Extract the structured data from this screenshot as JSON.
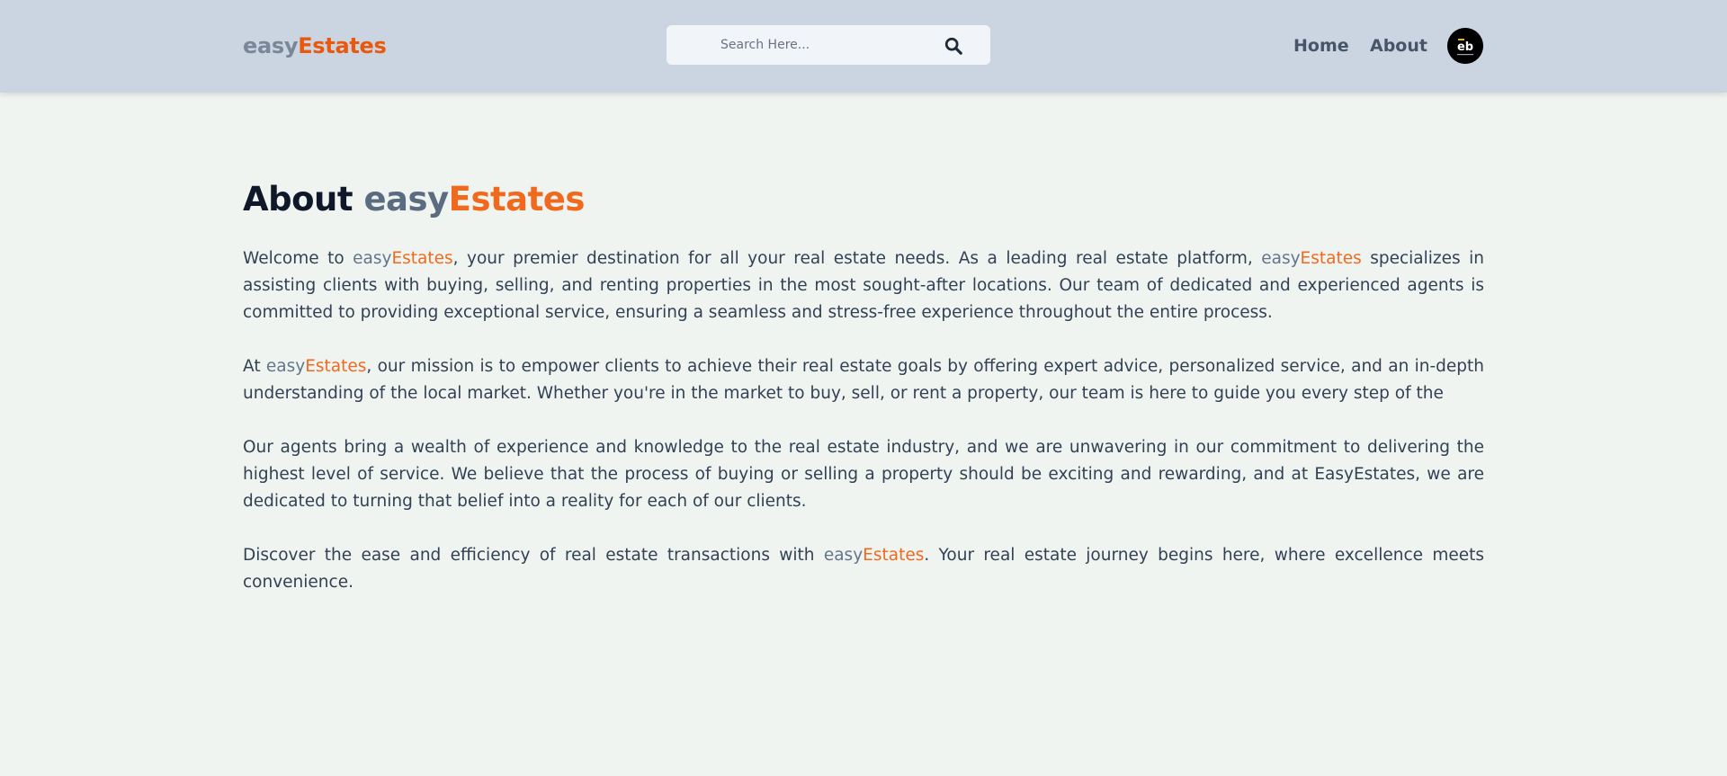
{
  "header": {
    "logo": {
      "prefix": "easy",
      "suffix": "Estates"
    },
    "search": {
      "placeholder": "Search Here...",
      "value": ""
    },
    "nav": {
      "home": "Home",
      "about": "About"
    },
    "avatar_label": "eb"
  },
  "brand": {
    "prefix": "easy",
    "suffix": "Estates"
  },
  "page": {
    "title_lead": "About ",
    "paragraphs": {
      "p1": {
        "a": "Welcome to ",
        "b": ", your premier destination for all your real estate needs. As a leading real estate platform, ",
        "c": " specializes in assisting clients with buying, selling, and renting properties in the most sought-after locations. Our team of dedicated and experienced agents is committed to providing exceptional service, ensuring a seamless and stress-free experience throughout the entire process."
      },
      "p2": {
        "a": "At ",
        "b": ", our mission is to empower clients to achieve their real estate goals by offering expert advice, personalized service, and an in-depth understanding of the local market. Whether you're in the market to buy, sell, or rent a property, our team is here to guide you every step of the"
      },
      "p3": {
        "a": "Our agents bring a wealth of experience and knowledge to the real estate industry, and we are unwavering in our commitment to delivering the highest level of service. We believe that the process of buying or selling a property should be exciting and rewarding, and at EasyEstates, we are dedicated to turning that belief into a reality for each of our clients."
      },
      "p4": {
        "a": "Discover the ease and efficiency of real estate transactions with ",
        "b": ". Your real estate journey begins here, where excellence meets convenience."
      }
    }
  },
  "colors": {
    "header_bg": "#cbd5e1",
    "page_bg": "#f0f4f1",
    "brand_gray": "#64748b",
    "brand_orange": "#ea580c"
  },
  "icons": {
    "search": "search-icon",
    "avatar": "avatar-logo"
  }
}
